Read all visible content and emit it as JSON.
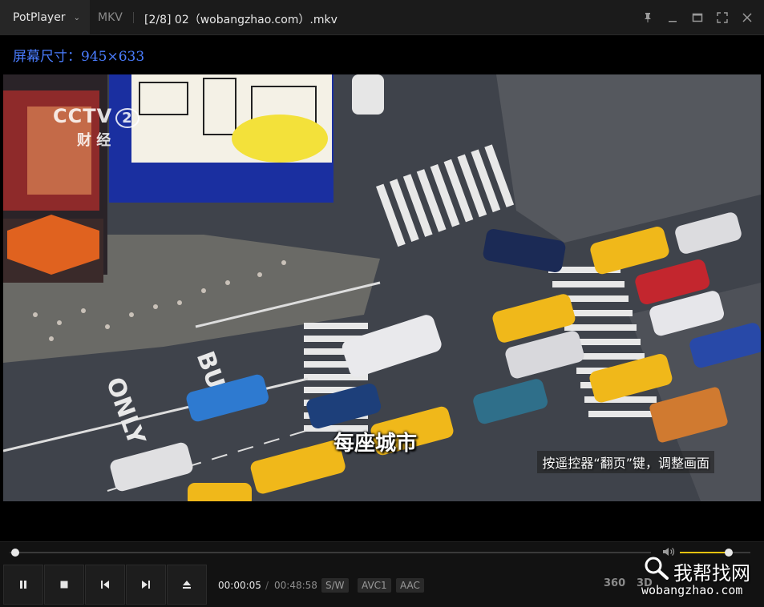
{
  "titlebar": {
    "app_name": "PotPlayer",
    "format": "MKV",
    "file_title": "[2/8] 02（wobangzhao.com）.mkv",
    "buttons": [
      "pin-icon",
      "minimize-icon",
      "maximize-icon",
      "fullscreen-icon",
      "close-icon"
    ]
  },
  "overlay": {
    "size_text": "屏幕尺寸：945×633"
  },
  "video": {
    "channel_logo": "CCTV",
    "channel_number": "2",
    "channel_sub": "财 经",
    "subtitle": "每座城市",
    "osd_message": "按遥控器“翻页”键，调整画面"
  },
  "player": {
    "seek_progress": 0.002,
    "volume": 0.69,
    "time_current": "00:00:05",
    "time_separator": "/",
    "time_duration": "00:48:58",
    "badges": [
      "S/W",
      "AVC1",
      "AAC"
    ],
    "right_icons": [
      "360",
      "3D"
    ],
    "accent_color": "#e4c10f"
  },
  "watermark": {
    "name": "我帮找网",
    "url": "wobangzhao.com"
  }
}
